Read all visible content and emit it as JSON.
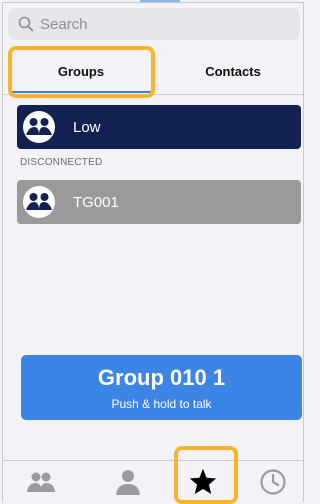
{
  "search": {
    "placeholder": "Search"
  },
  "tabs": [
    {
      "label": "Groups",
      "active": true
    },
    {
      "label": "Contacts",
      "active": false
    }
  ],
  "groups": [
    {
      "name": "Low",
      "color": "#132152"
    }
  ],
  "disconnected": {
    "header": "DISCONNECTED",
    "items": [
      {
        "name": "TG001",
        "color": "#9a9a9a"
      }
    ]
  },
  "ptt": {
    "title": "Group 010 1",
    "subtitle": "Push & hold to talk",
    "color": "#3c84e6"
  },
  "bottom_nav": [
    {
      "icon": "groups-icon",
      "active": false
    },
    {
      "icon": "contact-icon",
      "active": false
    },
    {
      "icon": "star-icon",
      "active": true
    },
    {
      "icon": "clock-icon",
      "active": false
    }
  ],
  "colors": {
    "highlight": "#f7b52b",
    "accent": "#3b7ee8",
    "inactive_icon": "#9a9a9f"
  }
}
